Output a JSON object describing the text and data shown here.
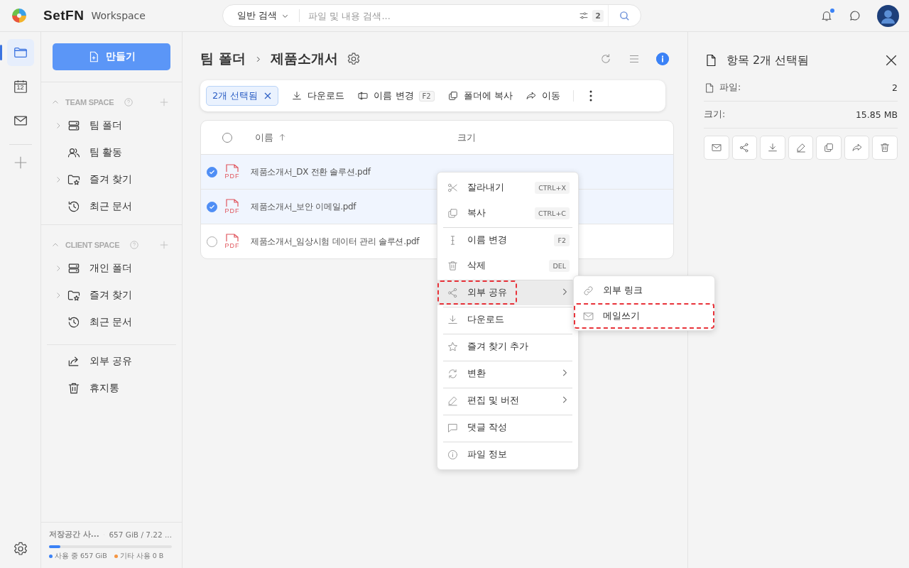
{
  "app": {
    "brand": "SetFN",
    "product": "Workspace"
  },
  "search": {
    "mode": "일반 검색",
    "placeholder": "파일 및 내용 검색...",
    "filter_count": "2"
  },
  "header": {
    "notification_unread": true
  },
  "rail": [
    {
      "kind": "folder",
      "selected": true
    },
    {
      "kind": "calendar",
      "selected": false,
      "label": "12"
    },
    {
      "kind": "mail",
      "selected": false
    }
  ],
  "sidebar": {
    "create_label": "만들기",
    "sections": [
      {
        "title": "TEAM SPACE",
        "expanded": true,
        "items": [
          {
            "kind": "drive",
            "label": "팀 폴더",
            "expandable": true
          },
          {
            "kind": "people",
            "label": "팀 활동",
            "expandable": false
          },
          {
            "kind": "star-folder",
            "label": "즐겨 찾기",
            "expandable": true
          },
          {
            "kind": "history",
            "label": "최근 문서",
            "expandable": false
          }
        ]
      },
      {
        "title": "CLIENT SPACE",
        "expanded": true,
        "items": [
          {
            "kind": "drive",
            "label": "개인 폴더",
            "expandable": true
          },
          {
            "kind": "star-folder",
            "label": "즐겨 찾기",
            "expandable": true
          },
          {
            "kind": "history",
            "label": "최근 문서",
            "expandable": false
          }
        ]
      }
    ],
    "extra_items": [
      {
        "kind": "share",
        "label": "외부 공유"
      },
      {
        "kind": "trash",
        "label": "휴지통"
      }
    ],
    "storage": {
      "label": "저장공간 사...",
      "total": "657 GiB / 7.22 ...",
      "level": 0.09,
      "legend": [
        {
          "label": "사용 중 657 GiB",
          "color": "#3b82f6"
        },
        {
          "label": "기타 사용 0 B",
          "color": "#f59542"
        }
      ]
    }
  },
  "breadcrumb": [
    "팀 폴더",
    "제품소개서"
  ],
  "toolbar": {
    "selection": "2개 선택됨",
    "actions": [
      {
        "kind": "download",
        "label": "다운로드"
      },
      {
        "kind": "rename",
        "label": "이름 변경",
        "shortcut": "F2"
      },
      {
        "kind": "copy",
        "label": "폴더에 복사"
      },
      {
        "kind": "move",
        "label": "이동"
      }
    ]
  },
  "table": {
    "columns": [
      "이름",
      "크기"
    ],
    "all_selected": false,
    "rows": [
      {
        "name": "제품소개서_DX 전환 솔루션.pdf",
        "type": "PDF",
        "selected": true
      },
      {
        "name": "제품소개서_보안 이메일.pdf",
        "type": "PDF",
        "selected": true
      },
      {
        "name": "제품소개서_임상시험 데이터 관리 솔루션.pdf",
        "type": "PDF",
        "selected": false
      }
    ]
  },
  "context_menu": {
    "items": [
      {
        "kind": "cut",
        "label": "잘라내기",
        "shortcut": "CTRL+X",
        "divider_before": false,
        "submenu": false,
        "hovered": false,
        "highlighted": false
      },
      {
        "kind": "copy",
        "label": "복사",
        "shortcut": "CTRL+C",
        "divider_before": false,
        "submenu": false,
        "hovered": false,
        "highlighted": false
      },
      {
        "kind": "cursor",
        "label": "이름 변경",
        "shortcut": "F2",
        "divider_before": true,
        "submenu": false,
        "hovered": false,
        "highlighted": false
      },
      {
        "kind": "trash",
        "label": "삭제",
        "shortcut": "DEL",
        "divider_before": false,
        "submenu": false,
        "hovered": false,
        "highlighted": false
      },
      {
        "kind": "share",
        "label": "외부 공유",
        "divider_before": true,
        "submenu": true,
        "hovered": true,
        "highlighted": true
      },
      {
        "kind": "download",
        "label": "다운로드",
        "divider_before": true,
        "submenu": false,
        "hovered": false,
        "highlighted": false
      },
      {
        "kind": "star",
        "label": "즐겨 찾기 추가",
        "divider_before": true,
        "submenu": false,
        "hovered": false,
        "highlighted": false
      },
      {
        "kind": "refresh",
        "label": "변환",
        "divider_before": true,
        "submenu": true,
        "hovered": false,
        "highlighted": false
      },
      {
        "kind": "pencil",
        "label": "편집 및 버전",
        "divider_before": true,
        "submenu": true,
        "hovered": false,
        "highlighted": false
      },
      {
        "kind": "comment",
        "label": "댓글 작성",
        "divider_before": true,
        "submenu": false,
        "hovered": false,
        "highlighted": false
      },
      {
        "kind": "info",
        "label": "파일 정보",
        "divider_before": true,
        "submenu": false,
        "hovered": false,
        "highlighted": false
      }
    ]
  },
  "submenu": [
    {
      "kind": "link",
      "label": "외부 링크",
      "highlighted": false
    },
    {
      "kind": "mail",
      "label": "메일쓰기",
      "highlighted": true
    }
  ],
  "details": {
    "title": "항목 2개 선택됨",
    "rows": [
      {
        "label": "파일:",
        "value": "2",
        "icon": true
      },
      {
        "label": "크기:",
        "value": "15.85 MB",
        "icon": false
      }
    ],
    "actions": [
      {
        "kind": "mail"
      },
      {
        "kind": "share"
      },
      {
        "kind": "download"
      },
      {
        "kind": "pencil"
      },
      {
        "kind": "copy"
      },
      {
        "kind": "move"
      },
      {
        "kind": "trash"
      }
    ]
  }
}
